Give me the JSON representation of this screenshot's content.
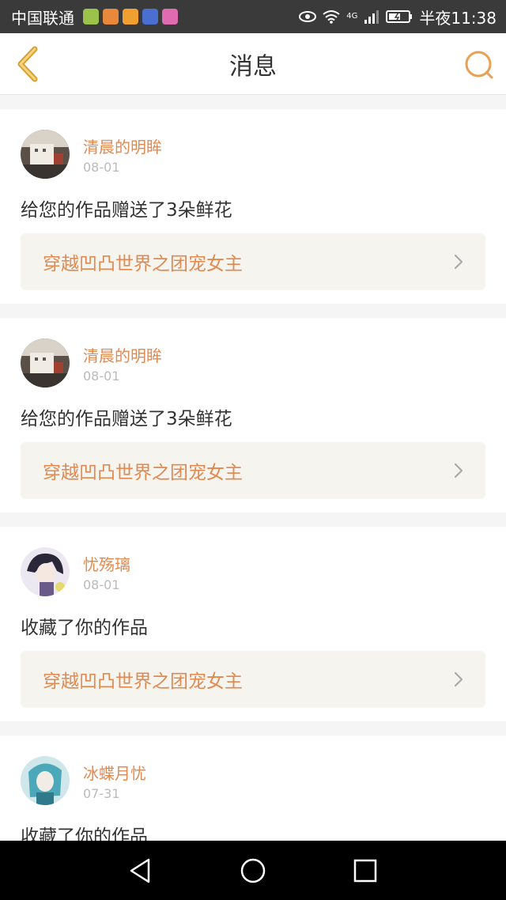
{
  "status_bar": {
    "carrier": "中国联通",
    "network": "4G",
    "time": "半夜11:38",
    "app_icons": [
      {
        "name": "chat-app-icon",
        "color": "#9bc34a"
      },
      {
        "name": "weibo-app-icon",
        "color": "#e8883a"
      },
      {
        "name": "shop-app-icon",
        "color": "#f0a030"
      },
      {
        "name": "uc-app-icon",
        "color": "#4a6fd0"
      },
      {
        "name": "camera-app-icon",
        "color": "#e06bb0"
      }
    ]
  },
  "header": {
    "title": "消息",
    "back_icon": "chevron-left-icon",
    "search_icon": "search-icon",
    "accent_color": "#e8a055"
  },
  "messages": [
    {
      "user": "清晨的明眸",
      "date": "08-01",
      "action": "给您的作品赠送了3朵鲜花",
      "work_title": "穿越凹凸世界之团宠女主"
    },
    {
      "user": "清晨的明眸",
      "date": "08-01",
      "action": "给您的作品赠送了3朵鲜花",
      "work_title": "穿越凹凸世界之团宠女主"
    },
    {
      "user": "忧殇璃",
      "date": "08-01",
      "action": "收藏了你的作品",
      "work_title": "穿越凹凸世界之团宠女主"
    },
    {
      "user": "冰蝶月忧",
      "date": "07-31",
      "action": "收藏了你的作品",
      "work_title": ""
    }
  ],
  "nav_bar": {
    "back": "triangle-back-icon",
    "home": "circle-home-icon",
    "recents": "square-recents-icon"
  }
}
